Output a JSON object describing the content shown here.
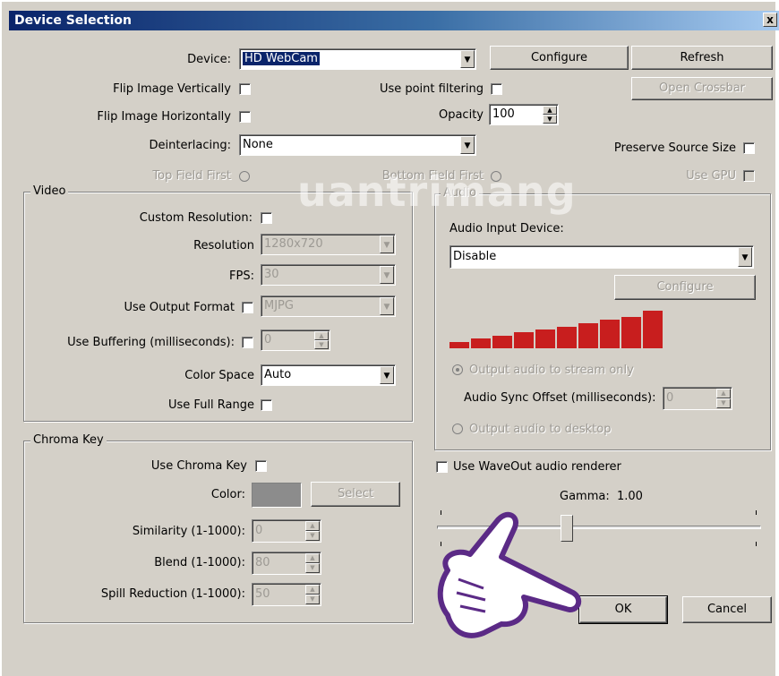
{
  "window": {
    "title": "Device Selection",
    "close_glyph": "x"
  },
  "device": {
    "label": "Device:",
    "value": "HD WebCam",
    "configure": "Configure",
    "refresh": "Refresh",
    "open_crossbar": "Open Crossbar"
  },
  "options": {
    "flip_vertical": "Flip Image Vertically",
    "flip_horizontal": "Flip Image Horizontally",
    "point_filtering": "Use point filtering",
    "opacity_label": "Opacity",
    "opacity_value": "100",
    "deinterlacing_label": "Deinterlacing:",
    "deinterlacing_value": "None",
    "preserve_source_size": "Preserve Source Size",
    "top_field_first": "Top Field First",
    "bottom_field_first": "Bottom Field First",
    "use_gpu": "Use GPU"
  },
  "video": {
    "legend": "Video",
    "custom_resolution": "Custom Resolution:",
    "resolution_label": "Resolution",
    "resolution_value": "1280x720",
    "fps_label": "FPS:",
    "fps_value": "30",
    "output_format_label": "Use Output Format",
    "output_format_value": "MJPG",
    "buffering_label": "Use Buffering (milliseconds):",
    "buffering_value": "0",
    "color_space_label": "Color Space",
    "color_space_value": "Auto",
    "full_range": "Use Full Range"
  },
  "chroma": {
    "legend": "Chroma Key",
    "use_chroma_key": "Use Chroma Key",
    "color_label": "Color:",
    "color_value": "#8c8c8c",
    "select": "Select",
    "similarity_label": "Similarity (1-1000):",
    "similarity_value": "0",
    "blend_label": "Blend (1-1000):",
    "blend_value": "80",
    "spill_label": "Spill Reduction (1-1000):",
    "spill_value": "50"
  },
  "audio": {
    "legend": "Audio",
    "input_device_label": "Audio Input Device:",
    "input_device_value": "Disable",
    "configure": "Configure",
    "output_stream_only": "Output audio to stream only",
    "sync_offset_label": "Audio Sync Offset (milliseconds):",
    "sync_offset_value": "0",
    "output_desktop": "Output audio to desktop",
    "meter_color": "#c81e1e",
    "meter_levels": [
      0.17,
      0.25,
      0.33,
      0.42,
      0.5,
      0.58,
      0.67,
      0.75,
      0.83,
      1.0
    ]
  },
  "waveout": {
    "label": "Use WaveOut audio renderer"
  },
  "gamma": {
    "label": "Gamma:",
    "value": "1.00"
  },
  "footer": {
    "ok": "OK",
    "cancel": "Cancel"
  },
  "watermark": {
    "text": "uantrimang"
  }
}
